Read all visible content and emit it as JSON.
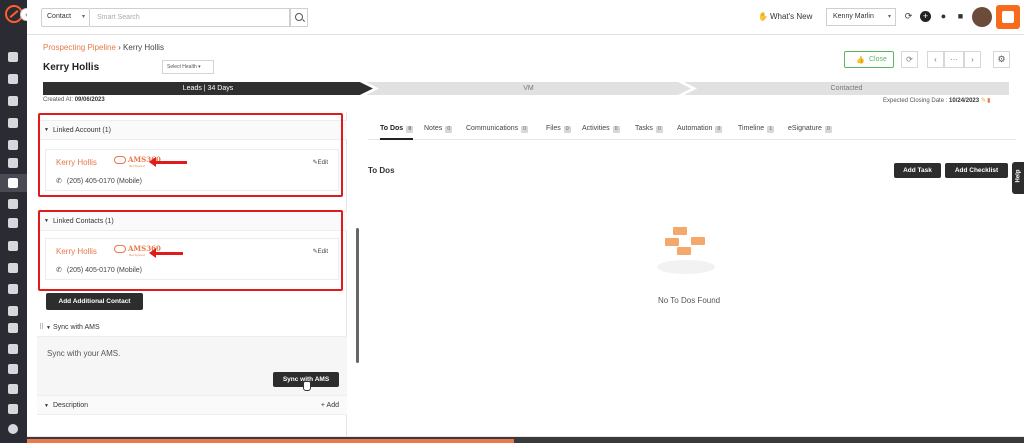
{
  "topbar": {
    "search_type": "Contact",
    "search_placeholder": "Smart Search",
    "whats_new": "What's New",
    "user": "Kenny Marlin"
  },
  "header": {
    "breadcrumb_link": "Prospecting Pipeline",
    "breadcrumb_sep": " › ",
    "breadcrumb_current": "Kerry Hollis",
    "title": "Kerry Hollis",
    "health_placeholder": "Select Health",
    "close_label": "Close",
    "pager_more": "···"
  },
  "stages": {
    "stage1": "Leads | 34 Days",
    "stage2": "VM",
    "stage3": "Contacted"
  },
  "dates": {
    "created_label": "Created At:",
    "created_value": "09/06/2023",
    "closing_label": "Expected Closing Date :",
    "closing_value": "10/24/2023"
  },
  "linked_account": {
    "title": "Linked Account (1)",
    "name": "Kerry Hollis",
    "ams": "AMS360",
    "ams_sub": "Not Synced",
    "phone": "(205) 405-0170 (Mobile)",
    "edit": "Edit"
  },
  "linked_contacts": {
    "title": "Linked Contacts (1)",
    "name": "Kerry Hollis",
    "ams": "AMS360",
    "ams_sub": "Not Synced",
    "phone": "(205) 405-0170 (Mobile)",
    "edit": "Edit"
  },
  "actions": {
    "add_contact": "Add Additional Contact",
    "sync_title": "Sync with AMS",
    "sync_text": "Sync with your AMS.",
    "sync_button": "Sync with AMS",
    "description": "Description",
    "desc_add": "+ Add"
  },
  "tabs": [
    {
      "label": "To Dos",
      "count": "0"
    },
    {
      "label": "Notes",
      "count": "0"
    },
    {
      "label": "Communications",
      "count": "0"
    },
    {
      "label": "Files",
      "count": "0"
    },
    {
      "label": "Activities",
      "count": "0"
    },
    {
      "label": "Tasks",
      "count": "0"
    },
    {
      "label": "Automation",
      "count": "0"
    },
    {
      "label": "Timeline",
      "count": "1"
    },
    {
      "label": "eSignature",
      "count": "0"
    }
  ],
  "todos": {
    "title": "To Dos",
    "add_task": "Add Task",
    "add_checklist": "Add Checklist",
    "empty": "No To Dos Found"
  },
  "help": "Help",
  "colors": {
    "accent": "#e8794b",
    "dark": "#2d2d2d",
    "sidebar": "#2b2b33",
    "highlight_red": "#e01b1b",
    "close_green": "#5cb85c"
  }
}
